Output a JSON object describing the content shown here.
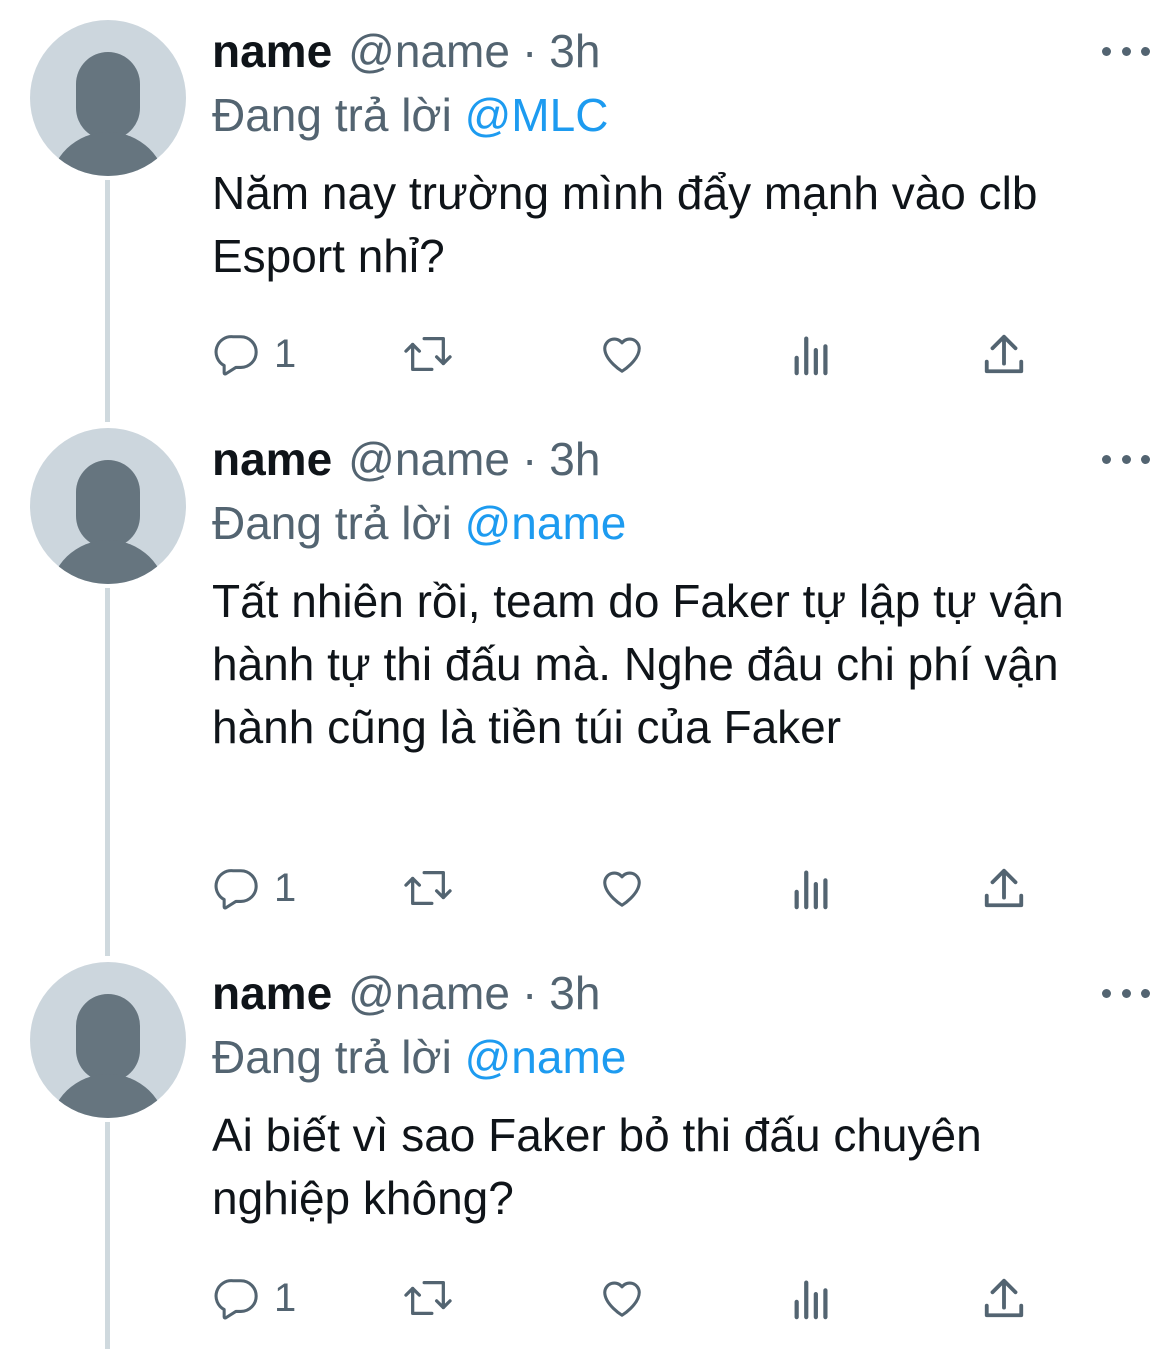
{
  "tweets": [
    {
      "name": "name",
      "handle": "@name",
      "separator": "·",
      "time": "3h",
      "reply_prefix": "Đang trả lời",
      "reply_to": "@MLC",
      "text": "Năm nay trường mình đẩy mạnh vào clb Esport nhỉ?",
      "reply_count": "1"
    },
    {
      "name": "name",
      "handle": "@name",
      "separator": "·",
      "time": "3h",
      "reply_prefix": "Đang trả lời",
      "reply_to": "@name",
      "text": "Tất nhiên rồi, team do Faker tự lập tự vận hành tự thi đấu mà. Nghe đâu chi phí vận hành cũng là tiền túi của Faker",
      "reply_count": "1"
    },
    {
      "name": "name",
      "handle": "@name",
      "separator": "·",
      "time": "3h",
      "reply_prefix": "Đang trả lời",
      "reply_to": "@name",
      "text": "Ai biết vì sao Faker bỏ thi đấu chuyên nghiệp không?",
      "reply_count": "1"
    }
  ],
  "icons": {
    "reply": "reply-icon",
    "retweet": "retweet-icon",
    "like": "heart-icon",
    "views": "analytics-icon",
    "share": "share-icon",
    "more": "more-icon"
  },
  "colors": {
    "text": "#0f1419",
    "secondary": "#536471",
    "mention": "#1d9bf0",
    "avatar_bg": "#ccd6dd",
    "avatar_fg": "#66757f",
    "thread_line": "#cfd9de"
  }
}
